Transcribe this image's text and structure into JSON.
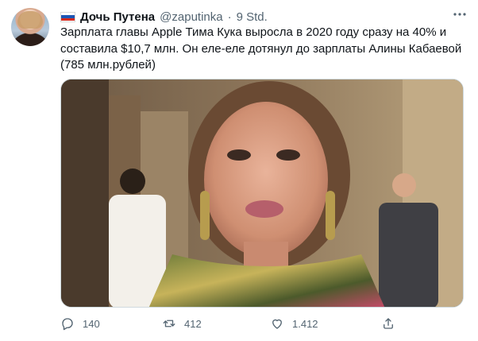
{
  "tweet": {
    "author_name": "Дочь Путена",
    "handle": "@zaputinka",
    "separator": "·",
    "time": "9 Std.",
    "text_lines": [
      "Зарплата главы Apple Тима Кука выросла в 2020 году сразу на 40% и",
      "составила $10,7 млн. Он еле-еле дотянул до зарплаты Алины Кабаевой",
      "(785 млн.рублей)"
    ],
    "more_icon": "more-horizontal-icon",
    "flag_colors": [
      "#ffffff",
      "#1c56b4",
      "#d52b1e"
    ]
  },
  "actions": {
    "reply_count": "140",
    "retweet_count": "412",
    "like_count": "1.412",
    "reply_icon": "reply-bubble-icon",
    "retweet_icon": "retweet-icon",
    "like_icon": "heart-icon",
    "share_icon": "share-icon"
  },
  "colors": {
    "text_primary": "#0f1419",
    "text_secondary": "#536471",
    "border": "#cfd9de"
  }
}
